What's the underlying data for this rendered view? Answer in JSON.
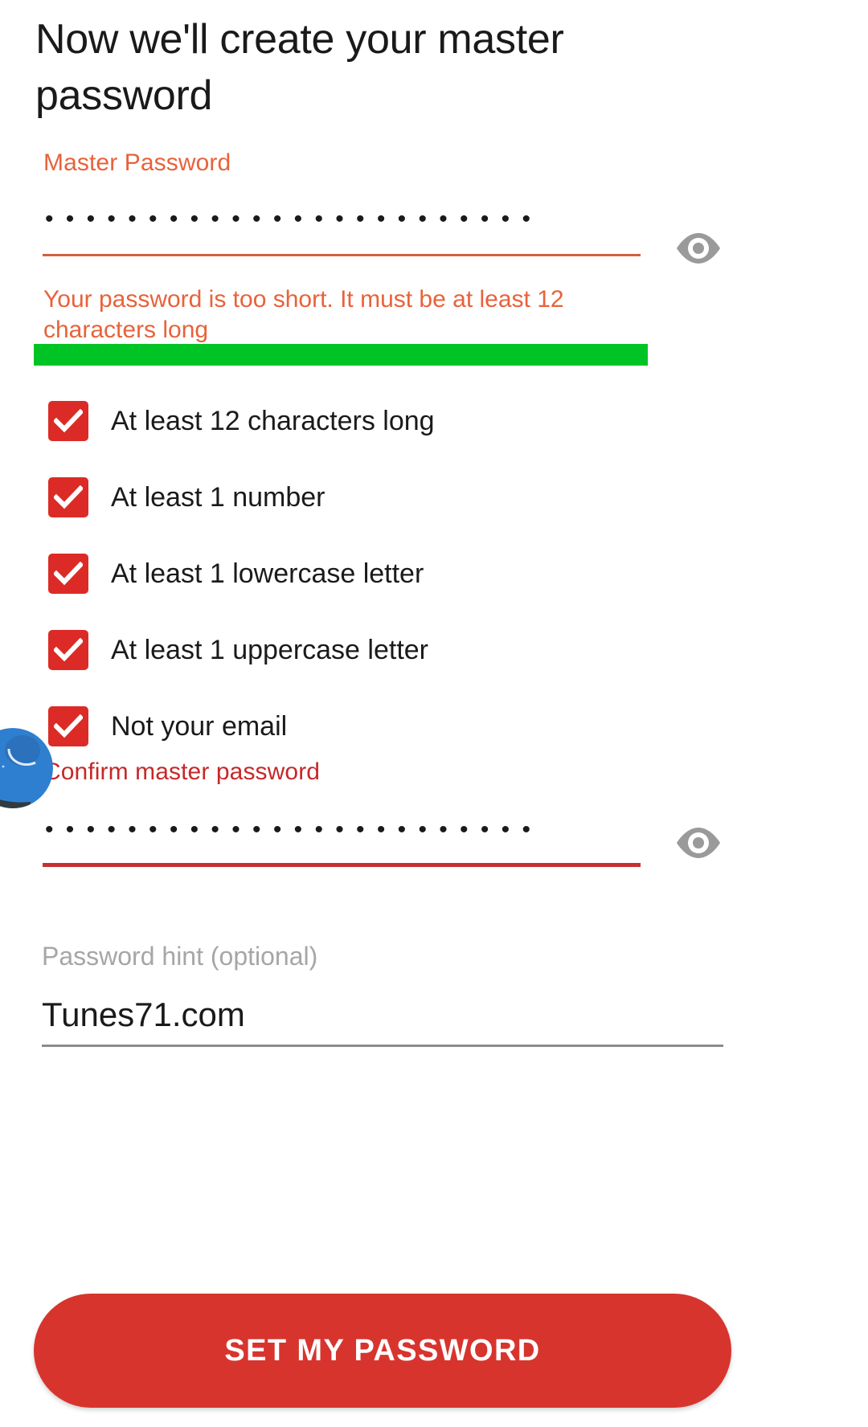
{
  "page": {
    "title": "Now we'll create your master password"
  },
  "master_password": {
    "label": "Master Password",
    "masked_value": "••••••••••••••••••••••••",
    "reveal_icon": "eye-icon",
    "error": "Your password is too short. It must be at least 12 characters long",
    "strength_color": "#00c425"
  },
  "requirements": [
    {
      "label": "At least 12 characters long",
      "checked": true
    },
    {
      "label": "At least 1 number",
      "checked": true
    },
    {
      "label": "At least 1 lowercase letter",
      "checked": true
    },
    {
      "label": "At least 1 uppercase letter",
      "checked": true
    },
    {
      "label": "Not your email",
      "checked": true
    }
  ],
  "confirm_password": {
    "label": "Confirm master password",
    "masked_value": "••••••••••••••••••••••••",
    "reveal_icon": "eye-icon"
  },
  "password_hint": {
    "label": "Password hint (optional)",
    "value": "Tunes71.com",
    "placeholder": "Password hint (optional)"
  },
  "submit": {
    "label": "SET MY PASSWORD"
  },
  "decor": {
    "avatar_icon": "planet-avatar-icon"
  },
  "colors": {
    "accent_orange": "#e8623a",
    "accent_red": "#dc2b26",
    "button_red": "#d8342e",
    "strength_green": "#00c425",
    "hint_gray": "#a6a6a6"
  }
}
